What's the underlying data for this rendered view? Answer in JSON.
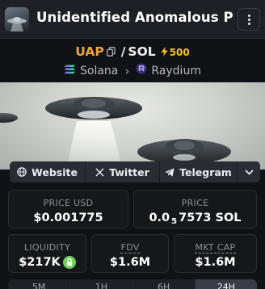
{
  "header": {
    "token_name": "Unidentified Anomalous Phen...",
    "more_icon": "kebab-menu-icon"
  },
  "pair": {
    "base": "UAP",
    "separator": "/",
    "quote": "SOL",
    "boost_count": "500",
    "copy_icon": "copy-icon",
    "boost_icon": "lightning-icon"
  },
  "chain": {
    "network": "Solana",
    "dex": "Raydium",
    "separator": "›"
  },
  "social": {
    "website": "Website",
    "twitter": "Twitter",
    "telegram": "Telegram"
  },
  "stats": {
    "price_usd": {
      "label": "PRICE USD",
      "value": "$0.001775"
    },
    "price_native": {
      "label": "PRICE",
      "value_prefix": "0.0",
      "zeros": "5",
      "value_suffix": "7573 SOL"
    },
    "liquidity": {
      "label": "LIQUIDITY",
      "value": "$217K"
    },
    "fdv": {
      "label": "FDV",
      "value": "$1.6M"
    },
    "mkt_cap": {
      "label": "MKT CAP",
      "value": "$1.6M"
    }
  },
  "tabs": [
    {
      "label": "5M"
    },
    {
      "label": "1H"
    },
    {
      "label": "6H"
    },
    {
      "label": "24H"
    }
  ],
  "colors": {
    "accent_base": "#f0a63c",
    "boost": "#f5c21b",
    "lock": "#6fcf5a",
    "raydium": "#6b5bd6"
  }
}
